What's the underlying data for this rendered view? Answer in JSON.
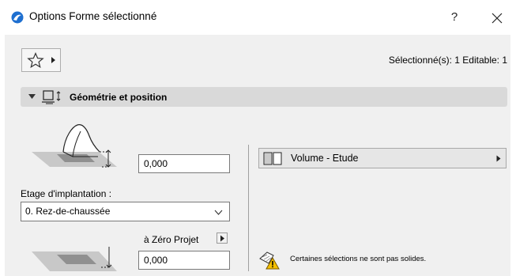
{
  "window": {
    "title": "Options Forme sélectionné",
    "help_label": "?",
    "close_label": "✕"
  },
  "toolbar": {
    "favorites_icon": "star-icon",
    "selection_info": "Sélectionné(s): 1 Editable: 1"
  },
  "section": {
    "title": "Géométrie et position",
    "expanded": true
  },
  "geometry": {
    "top_offset_value": "0,000",
    "story_label": "Etage d'implantation :",
    "story_value": "0. Rez-de-chaussée",
    "reference_label": "à Zéro Projet",
    "bottom_offset_value": "0,000"
  },
  "surface": {
    "volume_label": "Volume - Etude"
  },
  "warning": {
    "text": "Certaines sélections ne sont pas solides."
  },
  "colors": {
    "dialog_bg": "#f0f0f0",
    "section_bg": "#d9d9d9",
    "app_icon": "#1e6fd0"
  }
}
